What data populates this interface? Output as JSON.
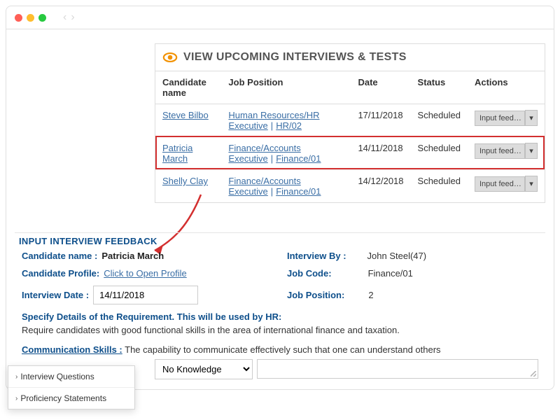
{
  "header": {
    "title": "VIEW UPCOMING INTERVIEWS & TESTS"
  },
  "columns": {
    "candidate": "Candidate name",
    "position": "Job Position",
    "date": "Date",
    "status": "Status",
    "actions": "Actions"
  },
  "rows": [
    {
      "candidate": "Steve Bilbo",
      "position_a": "Human Resources/HR Executive",
      "position_b": "HR/02",
      "date": "17/11/2018",
      "status": "Scheduled",
      "action_label": "Input feed…",
      "highlighted": false
    },
    {
      "candidate": "Patricia March",
      "position_a": "Finance/Accounts Executive",
      "position_b": "Finance/01",
      "date": "14/11/2018",
      "status": "Scheduled",
      "action_label": "Input feed…",
      "highlighted": true
    },
    {
      "candidate": "Shelly Clay",
      "position_a": "Finance/Accounts Executive",
      "position_b": "Finance/01",
      "date": "14/12/2018",
      "status": "Scheduled",
      "action_label": "Input feed…",
      "highlighted": false
    }
  ],
  "form": {
    "title": "INPUT INTERVIEW FEEDBACK",
    "candidate_name_label": "Candidate name :",
    "candidate_name_value": "Patricia March",
    "candidate_profile_label": "Candidate Profile:",
    "candidate_profile_link": "Click to Open Profile",
    "interview_date_label": "Interview Date :",
    "interview_date_value": "14/11/2018",
    "interview_by_label": "Interview By :",
    "interview_by_value": "John Steel(47)",
    "job_code_label": "Job Code:",
    "job_code_value": "Finance/01",
    "job_position_label": "Job Position:",
    "job_position_value": "2",
    "requirement_label": "Specify Details of the Requirement. This will be used by HR:",
    "requirement_text": "Require candidates with good functional skills in the area of international finance and taxation.",
    "comm_label": "Communication Skills :",
    "comm_desc": "The capability to communicate effectively such that one can understand others",
    "knowledge_selected": "No Knowledge"
  },
  "popup": {
    "item1": "Interview Questions",
    "item2": "Proficiency Statements"
  },
  "caret_symbol": "▾"
}
